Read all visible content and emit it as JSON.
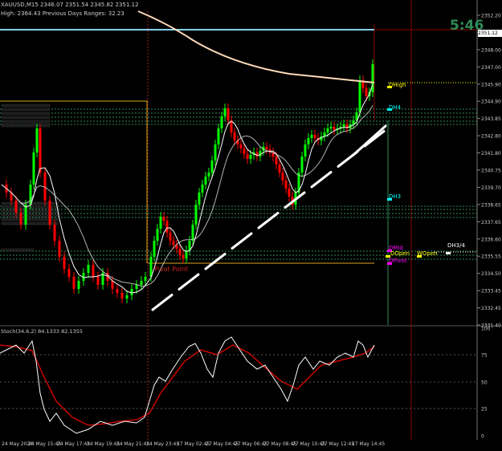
{
  "header": {
    "symbol_line": "XAUUSD,M15  2346.07 2351.54 2345.82 2351.12",
    "ranges_line": "High: 2364.43   Previous Days Ranges: 32.23"
  },
  "countdown": "5:46",
  "price_scale": {
    "ticks": [
      "2352.20",
      "2349.05",
      "2348.00",
      "2347.00",
      "2345.90",
      "2344.90",
      "2343.85",
      "2342.80",
      "2341.80",
      "2340.75",
      "2339.70",
      "2338.65",
      "2337.65",
      "2336.60",
      "2335.55",
      "2334.50",
      "2333.45",
      "2332.45",
      "2331.40"
    ],
    "current_price": "2351.12"
  },
  "level_labels": {
    "dhigh": "DHigh",
    "dh4": "DH4",
    "dh3": "DH3",
    "dmid": "DMid",
    "dopen": "DOpen",
    "wopen": "WOpen",
    "dh34": "DH3/4",
    "dpivot": "DPivot",
    "pivot_point": "Pivot Point"
  },
  "level_colors": {
    "dhigh_marker": "#ffff00",
    "dh4_marker": "#00ffff",
    "dh3_marker": "#00ffff",
    "dmid_marker": "#ff00ff",
    "dopen_marker": "#ffff00",
    "dpivot_marker": "#ff00ff"
  },
  "oscillator": {
    "label": "Stoch(34,6,2) 84.1333 82.1355",
    "ticks": [
      "100",
      "75",
      "50",
      "25",
      "0"
    ]
  },
  "time_axis": [
    "24 May 2024",
    "24 May 15:45",
    "24 May 17:45",
    "24 May 19:45",
    "24 May 21:45",
    "24 May 23:45",
    "27 May 02:45",
    "27 May 04:45",
    "27 May 06:45",
    "27 May 08:45",
    "27 May 10:45",
    "27 May 12:45",
    "27 May 14:45"
  ],
  "colors": {
    "bull": "#00ff00",
    "bear": "#ff0000",
    "ma_slow": "#ffdab9",
    "ma_fast": "#ffffff",
    "ma_mid": "#e0e0e0",
    "grid": "#ffffff",
    "accent_red": "#8b0000",
    "level_green": "#2e8b57"
  }
}
